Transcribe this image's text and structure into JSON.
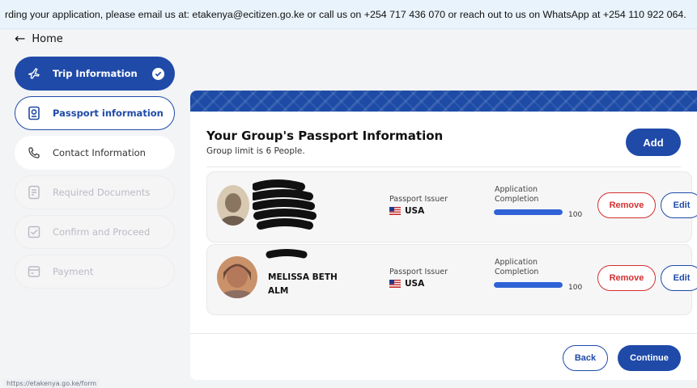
{
  "banner": {
    "text": "rding your application, please email us at: etakenya@ecitizen.go.ke or call us on +254 717 436 070 or reach out to us on WhatsApp at +254 110 922 064."
  },
  "nav": {
    "home_label": "Home"
  },
  "sidebar": {
    "items": [
      {
        "label": "Trip Information",
        "icon": "airplane-icon",
        "state": "completed"
      },
      {
        "label": "Passport information",
        "icon": "passport-icon",
        "state": "active"
      },
      {
        "label": "Contact Information",
        "icon": "phone-icon",
        "state": "enabled"
      },
      {
        "label": "Required Documents",
        "icon": "document-icon",
        "state": "disabled"
      },
      {
        "label": "Confirm and Proceed",
        "icon": "checkbox-icon",
        "state": "disabled"
      },
      {
        "label": "Payment",
        "icon": "payment-icon",
        "state": "disabled"
      }
    ]
  },
  "status_url": "https://etakenya.go.ke/form",
  "main": {
    "title": "Your Group's Passport Information",
    "subtitle": "Group limit is 6 People.",
    "add_label": "Add",
    "travelers": [
      {
        "name": "",
        "issuer_label": "Passport Issuer",
        "issuer_country": "USA",
        "completion_label": "Application Completion",
        "completion": 100,
        "completion_text": "100",
        "remove_label": "Remove",
        "edit_label": "Edit"
      },
      {
        "name": "MELISSA BETH ALM",
        "issuer_label": "Passport Issuer",
        "issuer_country": "USA",
        "completion_label": "Application Completion",
        "completion": 100,
        "completion_text": "100",
        "remove_label": "Remove",
        "edit_label": "Edit"
      }
    ],
    "back_label": "Back",
    "continue_label": "Continue"
  },
  "colors": {
    "primary": "#1f4aa8",
    "danger": "#d32f2f",
    "banner_bg": "#e9f3fb",
    "progress": "#2f62d6"
  }
}
